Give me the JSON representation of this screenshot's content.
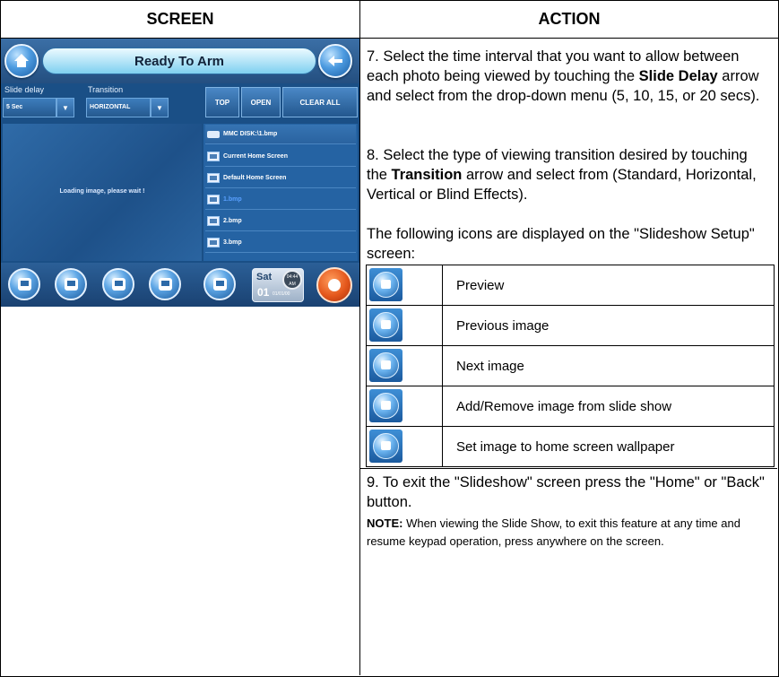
{
  "header": {
    "screen": "SCREEN",
    "action": "ACTION"
  },
  "device": {
    "status": "Ready To Arm",
    "slide_delay_label": "Slide delay",
    "slide_delay_value": "5 Sec",
    "transition_label": "Transition",
    "transition_value": "HORIZONTAL",
    "buttons": {
      "top": "TOP",
      "open": "OPEN",
      "clear_all": "CLEAR ALL"
    },
    "viewer_message": "Loading image, please wait !",
    "files": [
      {
        "name": "MMC DISK:\\1.bmp",
        "icon": "disk-icon"
      },
      {
        "name": "Current Home Screen",
        "icon": "image-icon"
      },
      {
        "name": "Default Home Screen",
        "icon": "image-icon"
      },
      {
        "name": "1.bmp",
        "icon": "image-icon",
        "selected": true
      },
      {
        "name": "2.bmp",
        "icon": "image-icon"
      },
      {
        "name": "3.bmp",
        "icon": "image-icon"
      }
    ],
    "clock": {
      "day": "Sat",
      "date": "01",
      "year": "01/01/00",
      "time": "04:44",
      "ampm": "AM"
    }
  },
  "action": {
    "step7_pre": "7. Select the time interval that you want to allow between each photo being viewed by touching the ",
    "step7_bold": "Slide Delay",
    "step7_post": " arrow and select from the drop-down menu (5, 10, 15, or 20 secs).",
    "step8_pre": "8. Select the type of viewing transition desired by touching the ",
    "step8_bold": "Transition",
    "step8_post": " arrow and select from (Standard, Horizontal, Vertical or Blind Effects).",
    "icons_intro": "The following icons are displayed on the \"Slideshow Setup\" screen:",
    "icons": [
      {
        "label": "Preview",
        "icon": "preview-icon"
      },
      {
        "label": "Previous image",
        "icon": "previous-image-icon"
      },
      {
        "label": "Next image",
        "icon": "next-image-icon"
      },
      {
        "label": "Add/Remove image from slide show",
        "icon": "add-remove-image-icon"
      },
      {
        "label": "Set image to home screen wallpaper",
        "icon": "set-wallpaper-icon"
      }
    ],
    "step9": "9. To exit the \"Slideshow\" screen press the \"Home\" or \"Back\" button.",
    "note_bold": "NOTE:",
    "note_text": " When viewing the Slide Show, to exit this feature at any time and resume keypad operation, press anywhere on the screen."
  }
}
